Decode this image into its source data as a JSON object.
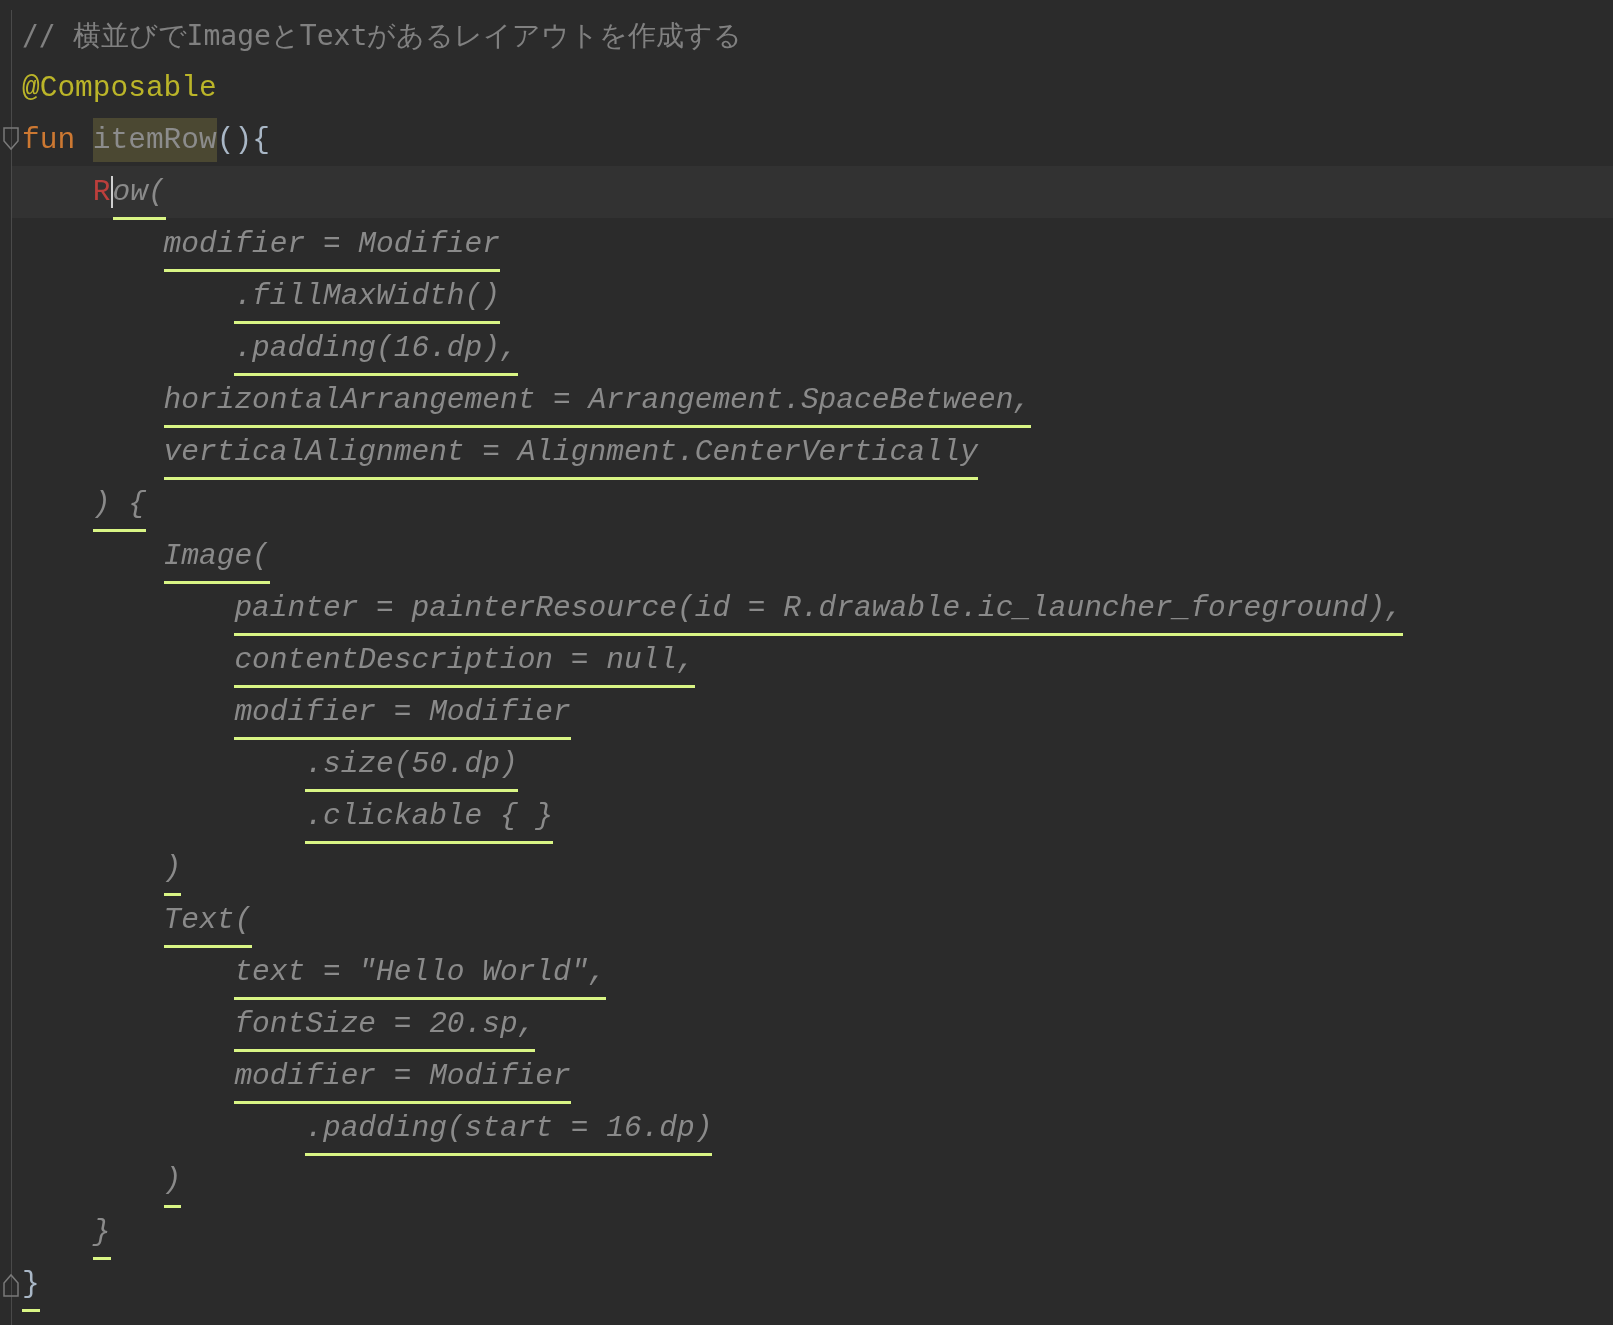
{
  "editor": {
    "lines": [
      {
        "tokens": [
          {
            "text": "// 横並びでImageとTextがあるレイアウトを作成する",
            "kind": "comment",
            "underlined": false
          }
        ]
      },
      {
        "tokens": [
          {
            "text": "@Composable",
            "kind": "annotation",
            "underlined": false
          }
        ]
      },
      {
        "fold_start": true,
        "tokens": [
          {
            "text": "fun ",
            "kind": "keyword",
            "underlined": false
          },
          {
            "text": "itemRow",
            "kind": "function",
            "underlined": false,
            "highlighted": true
          },
          {
            "text": "(){",
            "kind": "punct",
            "underlined": false
          }
        ],
        "children": [
          {
            "current": true,
            "tokens": [
              {
                "text": "R",
                "kind": "error",
                "underlined": false
              },
              {
                "text": "ow(",
                "kind": "dim",
                "underlined": true,
                "caret": true
              }
            ],
            "children": [
              {
                "tokens": [
                  {
                    "text": "modifier = Modifier",
                    "kind": "dim",
                    "underlined": true
                  }
                ],
                "children": [
                  {
                    "tokens": [
                      {
                        "text": ".fillMaxWidth()",
                        "kind": "dim",
                        "underlined": true
                      }
                    ]
                  },
                  {
                    "tokens": [
                      {
                        "text": ".padding(16.dp),",
                        "kind": "dim",
                        "underlined": true
                      }
                    ]
                  }
                ]
              },
              {
                "tokens": [
                  {
                    "text": "horizontalArrangement = Arrangement.SpaceBetween,",
                    "kind": "dim",
                    "underlined": true
                  }
                ]
              },
              {
                "tokens": [
                  {
                    "text": "verticalAlignment = Alignment.CenterVertically",
                    "kind": "dim",
                    "underlined": true
                  }
                ]
              }
            ]
          },
          {
            "tokens": [
              {
                "text": ") {",
                "kind": "dim",
                "underlined": true
              }
            ],
            "children": [
              {
                "tokens": [
                  {
                    "text": "Image(",
                    "kind": "dim",
                    "underlined": true
                  }
                ],
                "children": [
                  {
                    "tokens": [
                      {
                        "text": "painter = painterResource(id = R.drawable.ic_launcher_foreground),",
                        "kind": "dim",
                        "underlined": true
                      }
                    ]
                  },
                  {
                    "tokens": [
                      {
                        "text": "contentDescription = null,",
                        "kind": "dim",
                        "underlined": true
                      }
                    ]
                  },
                  {
                    "tokens": [
                      {
                        "text": "modifier = Modifier",
                        "kind": "dim",
                        "underlined": true
                      }
                    ],
                    "children": [
                      {
                        "tokens": [
                          {
                            "text": ".size(50.dp)",
                            "kind": "dim",
                            "underlined": true
                          }
                        ]
                      },
                      {
                        "tokens": [
                          {
                            "text": ".clickable { }",
                            "kind": "dim",
                            "underlined": true
                          }
                        ]
                      }
                    ]
                  }
                ]
              },
              {
                "tokens": [
                  {
                    "text": ")",
                    "kind": "dim",
                    "underlined": true
                  }
                ]
              },
              {
                "tokens": [
                  {
                    "text": "Text(",
                    "kind": "dim",
                    "underlined": true
                  }
                ],
                "children": [
                  {
                    "tokens": [
                      {
                        "text": "text = \"Hello World\",",
                        "kind": "dim",
                        "underlined": true
                      }
                    ]
                  },
                  {
                    "tokens": [
                      {
                        "text": "fontSize = 20.sp,",
                        "kind": "dim",
                        "underlined": true
                      }
                    ]
                  },
                  {
                    "tokens": [
                      {
                        "text": "modifier = Modifier",
                        "kind": "dim",
                        "underlined": true
                      }
                    ],
                    "children": [
                      {
                        "tokens": [
                          {
                            "text": ".padding(start = 16.dp)",
                            "kind": "dim",
                            "underlined": true
                          }
                        ]
                      }
                    ]
                  }
                ]
              },
              {
                "tokens": [
                  {
                    "text": ")",
                    "kind": "dim",
                    "underlined": true
                  }
                ]
              }
            ]
          },
          {
            "tokens": [
              {
                "text": "}",
                "kind": "dim",
                "underlined": true
              }
            ]
          }
        ]
      },
      {
        "fold_end": true,
        "tokens": [
          {
            "text": "}",
            "kind": "punct",
            "underlined": true
          }
        ]
      }
    ]
  }
}
